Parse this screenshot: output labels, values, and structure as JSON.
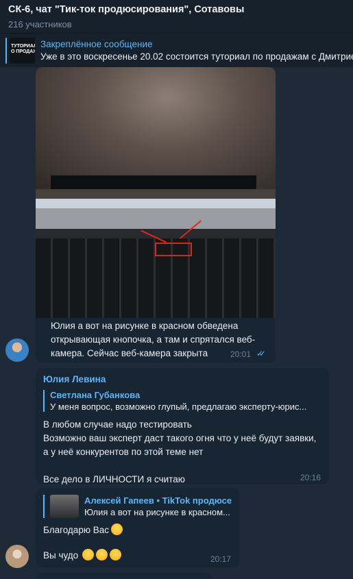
{
  "header": {
    "title": "СК-6, чат \"Тик-ток продюсирования\", Сотавовы",
    "subtitle": "216 участников"
  },
  "pinned": {
    "label": "Закреплённое сообщение",
    "preview": "Уже в это воскресенье 20.02 состоится туториал по продажам с Дмитрием",
    "thumb_line1": "ТУТОРИАЛ",
    "thumb_line2": "О ПРОДАЖА"
  },
  "messages": {
    "photo_msg": {
      "caption": "Юлия а вот на рисунке в красном обведена открывающая кнопочка, а там и спрятался веб-камера. Сейчас веб-камера закрыта",
      "time": "20:01",
      "status_icon": "double-check-icon"
    },
    "msg2": {
      "sender": "Юлия Левина",
      "reply_name": "Светлана Губанкова",
      "reply_text": "У меня вопрос, возможно глупый, предлагаю эксперту-юрис...",
      "text": "В любом случае надо тестировать\nВозможно ваш эксперт даст такого огня что у неё будут заявки, а у неё конкурентов по этой теме нет\n\nВсе дело в ЛИЧНОСТИ я считаю",
      "time": "20:16"
    },
    "msg3": {
      "reply_name": "Алексей Гапеев • TikTok продюсер",
      "reply_text": "Юлия а вот на рисунке в красном...",
      "line1": "Благодарю Вас",
      "line2": "Вы чудо",
      "time": "20:17",
      "emoji_icons": [
        "star-struck-emoji",
        "smiling-face-hearts-emoji",
        "smiling-face-hearts-emoji",
        "smiling-face-hearts-emoji"
      ]
    }
  },
  "colors": {
    "accent": "#5eb5f7",
    "header_bg": "#17212b",
    "bubble_bg": "#182533",
    "chat_bg": "#1e2a38"
  }
}
